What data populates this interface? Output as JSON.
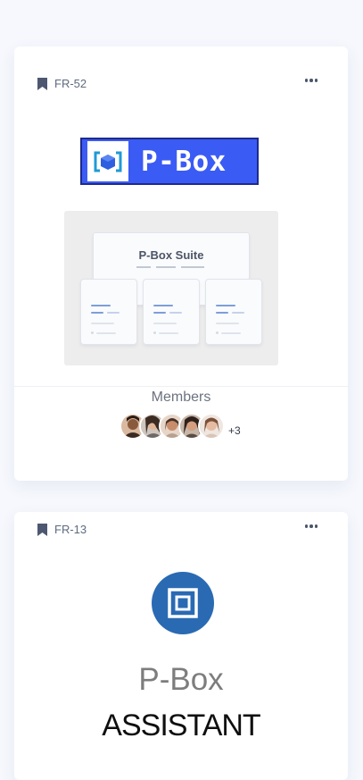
{
  "cards": [
    {
      "tag": "FR-52",
      "logo_text": "P-Box",
      "preview_title": "P-Box Suite",
      "members_label": "Members",
      "extra_members": "+3",
      "member_count_visible": 5
    },
    {
      "tag": "FR-13",
      "title": "P-Box",
      "subtitle": "ASSISTANT"
    }
  ],
  "icons": {
    "bookmark": "bookmark-icon",
    "more": "more-horizontal-icon",
    "logo": "cube-bracket-icon",
    "assistant": "square-frame-icon"
  },
  "colors": {
    "page_bg": "#f6f8fd",
    "logo_blue": "#3b5bf5",
    "assistant_blue": "#2a6ab3"
  }
}
